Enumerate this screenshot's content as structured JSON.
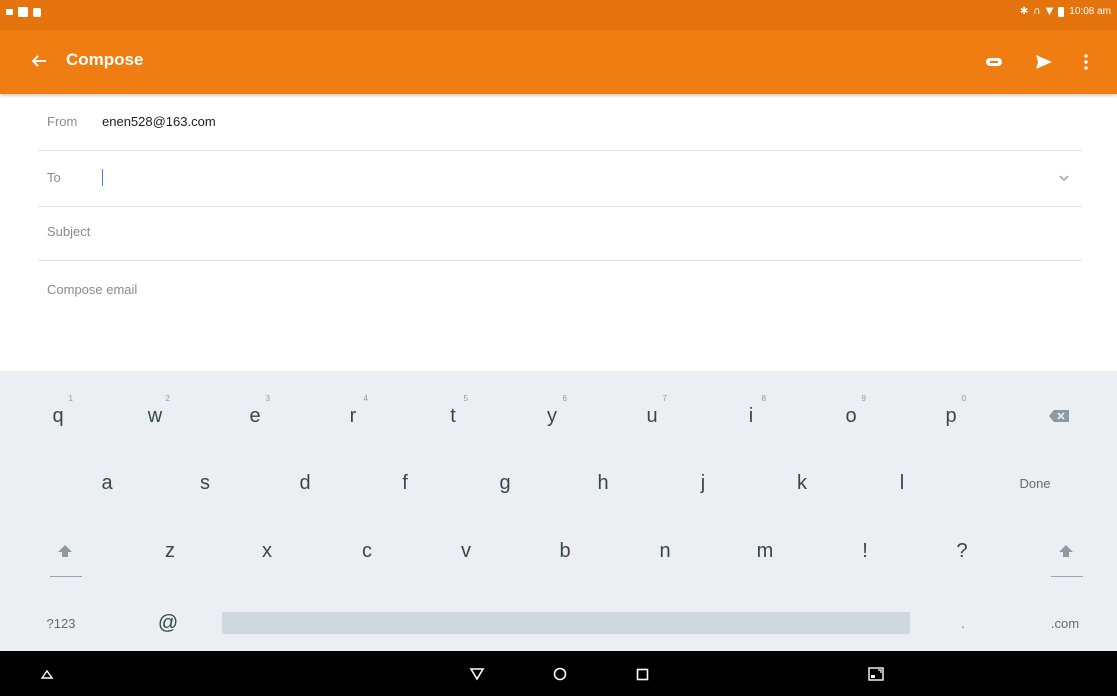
{
  "status_bar": {
    "time": "10:08 am",
    "left_icons": [
      "image-icon",
      "message-icon",
      "lock-icon"
    ],
    "right_icons": [
      "bluetooth-icon",
      "headset-icon",
      "wifi-icon",
      "battery-icon"
    ]
  },
  "app_bar": {
    "title": "Compose",
    "background": "#f07d11",
    "actions": [
      "attach-icon",
      "send-icon",
      "more-vert-icon"
    ]
  },
  "compose": {
    "from_label": "From",
    "from_value": "enen528@163.com",
    "to_label": "To",
    "to_value": "",
    "subject_placeholder": "Subject",
    "body_placeholder": "Compose email"
  },
  "keyboard": {
    "row1": [
      {
        "key": "q",
        "hint": "1"
      },
      {
        "key": "w",
        "hint": "2"
      },
      {
        "key": "e",
        "hint": "3"
      },
      {
        "key": "r",
        "hint": "4"
      },
      {
        "key": "t",
        "hint": "5"
      },
      {
        "key": "y",
        "hint": "6"
      },
      {
        "key": "u",
        "hint": "7"
      },
      {
        "key": "i",
        "hint": "8"
      },
      {
        "key": "o",
        "hint": "9"
      },
      {
        "key": "p",
        "hint": "0"
      }
    ],
    "row2": [
      "a",
      "s",
      "d",
      "f",
      "g",
      "h",
      "j",
      "k",
      "l"
    ],
    "done_label": "Done",
    "row3": [
      "z",
      "x",
      "c",
      "v",
      "b",
      "n",
      "m",
      "!",
      "?"
    ],
    "symbols_label": "?123",
    "at_label": "@",
    "period_label": ".",
    "dotcom_label": ".com"
  },
  "nav_bar": {
    "buttons": [
      "hide-keyboard-icon",
      "back-icon",
      "home-icon",
      "recents-icon",
      "screen-mode-icon"
    ]
  }
}
